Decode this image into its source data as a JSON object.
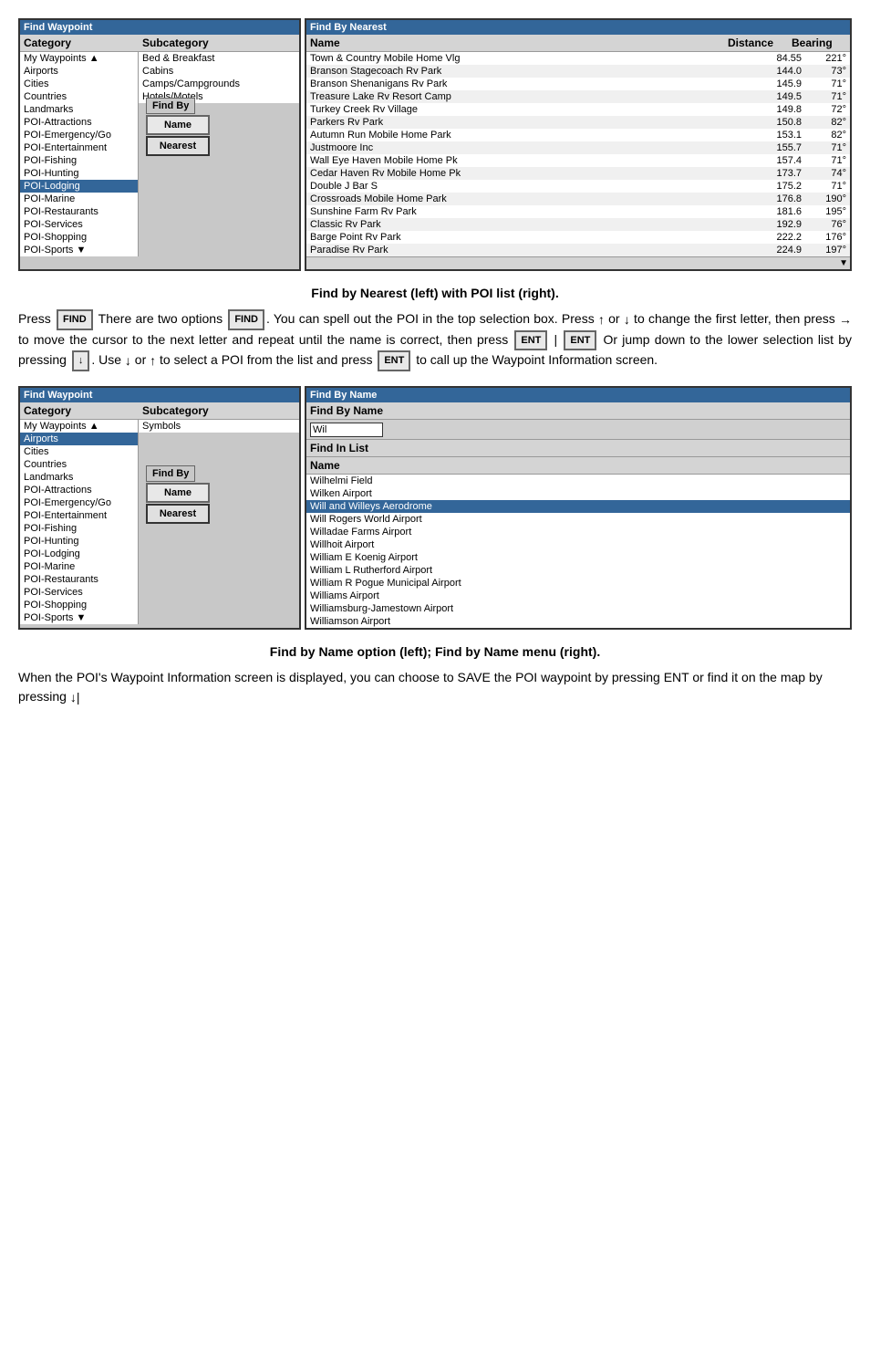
{
  "top_left_panel": {
    "title": "Find Waypoint",
    "header": {
      "category": "Category",
      "subcategory": "Subcategory"
    },
    "categories": [
      {
        "label": "My Waypoints",
        "selected": false
      },
      {
        "label": "Airports",
        "selected": false
      },
      {
        "label": "Cities",
        "selected": false
      },
      {
        "label": "Countries",
        "selected": false
      },
      {
        "label": "Landmarks",
        "selected": false
      },
      {
        "label": "POI-Attractions",
        "selected": false
      },
      {
        "label": "POI-Emergency/Go",
        "selected": false
      },
      {
        "label": "POI-Entertainment",
        "selected": false
      },
      {
        "label": "POI-Fishing",
        "selected": false
      },
      {
        "label": "POI-Hunting",
        "selected": false
      },
      {
        "label": "POI-Lodging",
        "selected": true
      },
      {
        "label": "POI-Marine",
        "selected": false
      },
      {
        "label": "POI-Restaurants",
        "selected": false
      },
      {
        "label": "POI-Services",
        "selected": false
      },
      {
        "label": "POI-Shopping",
        "selected": false
      },
      {
        "label": "POI-Sports",
        "selected": false
      }
    ],
    "subcategories": [
      {
        "label": "Bed & Breakfast"
      },
      {
        "label": "Cabins"
      },
      {
        "label": "Camps/Campgrounds"
      },
      {
        "label": "Hotels/Motels"
      }
    ],
    "find_by_label": "Find By",
    "btn_name": "Name",
    "btn_nearest": "Nearest"
  },
  "top_right_panel": {
    "title": "Find By Nearest",
    "header": {
      "name": "Name",
      "distance": "Distance",
      "bearing": "Bearing"
    },
    "results": [
      {
        "name": "Town & Country Mobile Home Vlg",
        "distance": "84.55",
        "bearing": "221°"
      },
      {
        "name": "Branson Stagecoach Rv Park",
        "distance": "144.0",
        "bearing": "73°"
      },
      {
        "name": "Branson Shenanigans Rv Park",
        "distance": "145.9",
        "bearing": "71°"
      },
      {
        "name": "Treasure Lake Rv Resort Camp",
        "distance": "149.5",
        "bearing": "71°"
      },
      {
        "name": "Turkey Creek Rv Village",
        "distance": "149.8",
        "bearing": "72°"
      },
      {
        "name": "Parkers Rv Park",
        "distance": "150.8",
        "bearing": "82°"
      },
      {
        "name": "Autumn Run Mobile Home Park",
        "distance": "153.1",
        "bearing": "82°"
      },
      {
        "name": "Justmoore Inc",
        "distance": "155.7",
        "bearing": "71°"
      },
      {
        "name": "Wall Eye Haven Mobile Home Pk",
        "distance": "157.4",
        "bearing": "71°"
      },
      {
        "name": "Cedar Haven Rv Mobile Home Pk",
        "distance": "173.7",
        "bearing": "74°"
      },
      {
        "name": "Double J Bar S",
        "distance": "175.2",
        "bearing": "71°"
      },
      {
        "name": "Crossroads Mobile Home Park",
        "distance": "176.8",
        "bearing": "190°"
      },
      {
        "name": "Sunshine Farm Rv Park",
        "distance": "181.6",
        "bearing": "195°"
      },
      {
        "name": "Classic Rv Park",
        "distance": "192.9",
        "bearing": "76°"
      },
      {
        "name": "Barge Point Rv Park",
        "distance": "222.2",
        "bearing": "176°"
      },
      {
        "name": "Paradise Rv Park",
        "distance": "224.9",
        "bearing": "197°"
      }
    ]
  },
  "caption1": "Find by Nearest (left) with POI list (right).",
  "body_paragraph1": {
    "text_parts": [
      "Press",
      " There are two options ",
      " . You can spell out the POI in the top selection box. Press ",
      " or ",
      " to change the first letter, then press ",
      " to move the cursor to the next letter and repeat until the name is correct, then press ",
      " | ",
      " Or jump down to the lower selection list by pressing ",
      " . Use ",
      " or ",
      " to select a POI from the list and press ",
      " to call up the Waypoint Information screen."
    ]
  },
  "bottom_left_panel": {
    "title": "Find Waypoint",
    "header": {
      "category": "Category",
      "subcategory": "Subcategory"
    },
    "categories": [
      {
        "label": "My Waypoints",
        "selected": false
      },
      {
        "label": "Airports",
        "selected": true
      },
      {
        "label": "Cities",
        "selected": false
      },
      {
        "label": "Countries",
        "selected": false
      },
      {
        "label": "Landmarks",
        "selected": false
      },
      {
        "label": "POI-Attractions",
        "selected": false
      },
      {
        "label": "POI-Emergency/Go",
        "selected": false
      },
      {
        "label": "POI-Entertainment",
        "selected": false
      },
      {
        "label": "POI-Fishing",
        "selected": false
      },
      {
        "label": "POI-Hunting",
        "selected": false
      },
      {
        "label": "POI-Lodging",
        "selected": false
      },
      {
        "label": "POI-Marine",
        "selected": false
      },
      {
        "label": "POI-Restaurants",
        "selected": false
      },
      {
        "label": "POI-Services",
        "selected": false
      },
      {
        "label": "POI-Shopping",
        "selected": false
      },
      {
        "label": "POI-Sports",
        "selected": false
      }
    ],
    "subcategories": [
      {
        "label": "Symbols"
      }
    ],
    "find_by_label": "Find By",
    "btn_name": "Name",
    "btn_nearest": "Nearest"
  },
  "bottom_right_panel": {
    "title": "Find By Name",
    "find_by_name_label": "Find By Name",
    "input_value": "Wil",
    "find_in_list_label": "Find In List",
    "name_col_header": "Name",
    "results": [
      {
        "name": "Wilhelmi Field",
        "selected": false
      },
      {
        "name": "Wilken Airport",
        "selected": false
      },
      {
        "name": "Will and Willeys Aerodrome",
        "selected": true
      },
      {
        "name": "Will Rogers World Airport",
        "selected": false
      },
      {
        "name": "Willadae Farms Airport",
        "selected": false
      },
      {
        "name": "Willhoit Airport",
        "selected": false
      },
      {
        "name": "William E Koenig Airport",
        "selected": false
      },
      {
        "name": "William L Rutherford Airport",
        "selected": false
      },
      {
        "name": "William R Pogue Municipal Airport",
        "selected": false
      },
      {
        "name": "Williams Airport",
        "selected": false
      },
      {
        "name": "Williamsburg-Jamestown Airport",
        "selected": false
      },
      {
        "name": "Williamson Airport",
        "selected": false
      }
    ]
  },
  "caption2": "Find by Name option (left); Find by Name menu (right).",
  "body_paragraph2": "When the POI's Waypoint Information screen is displayed, you can choose to        the POI waypoint by pressing        or find it on the map by pressing ↓|"
}
